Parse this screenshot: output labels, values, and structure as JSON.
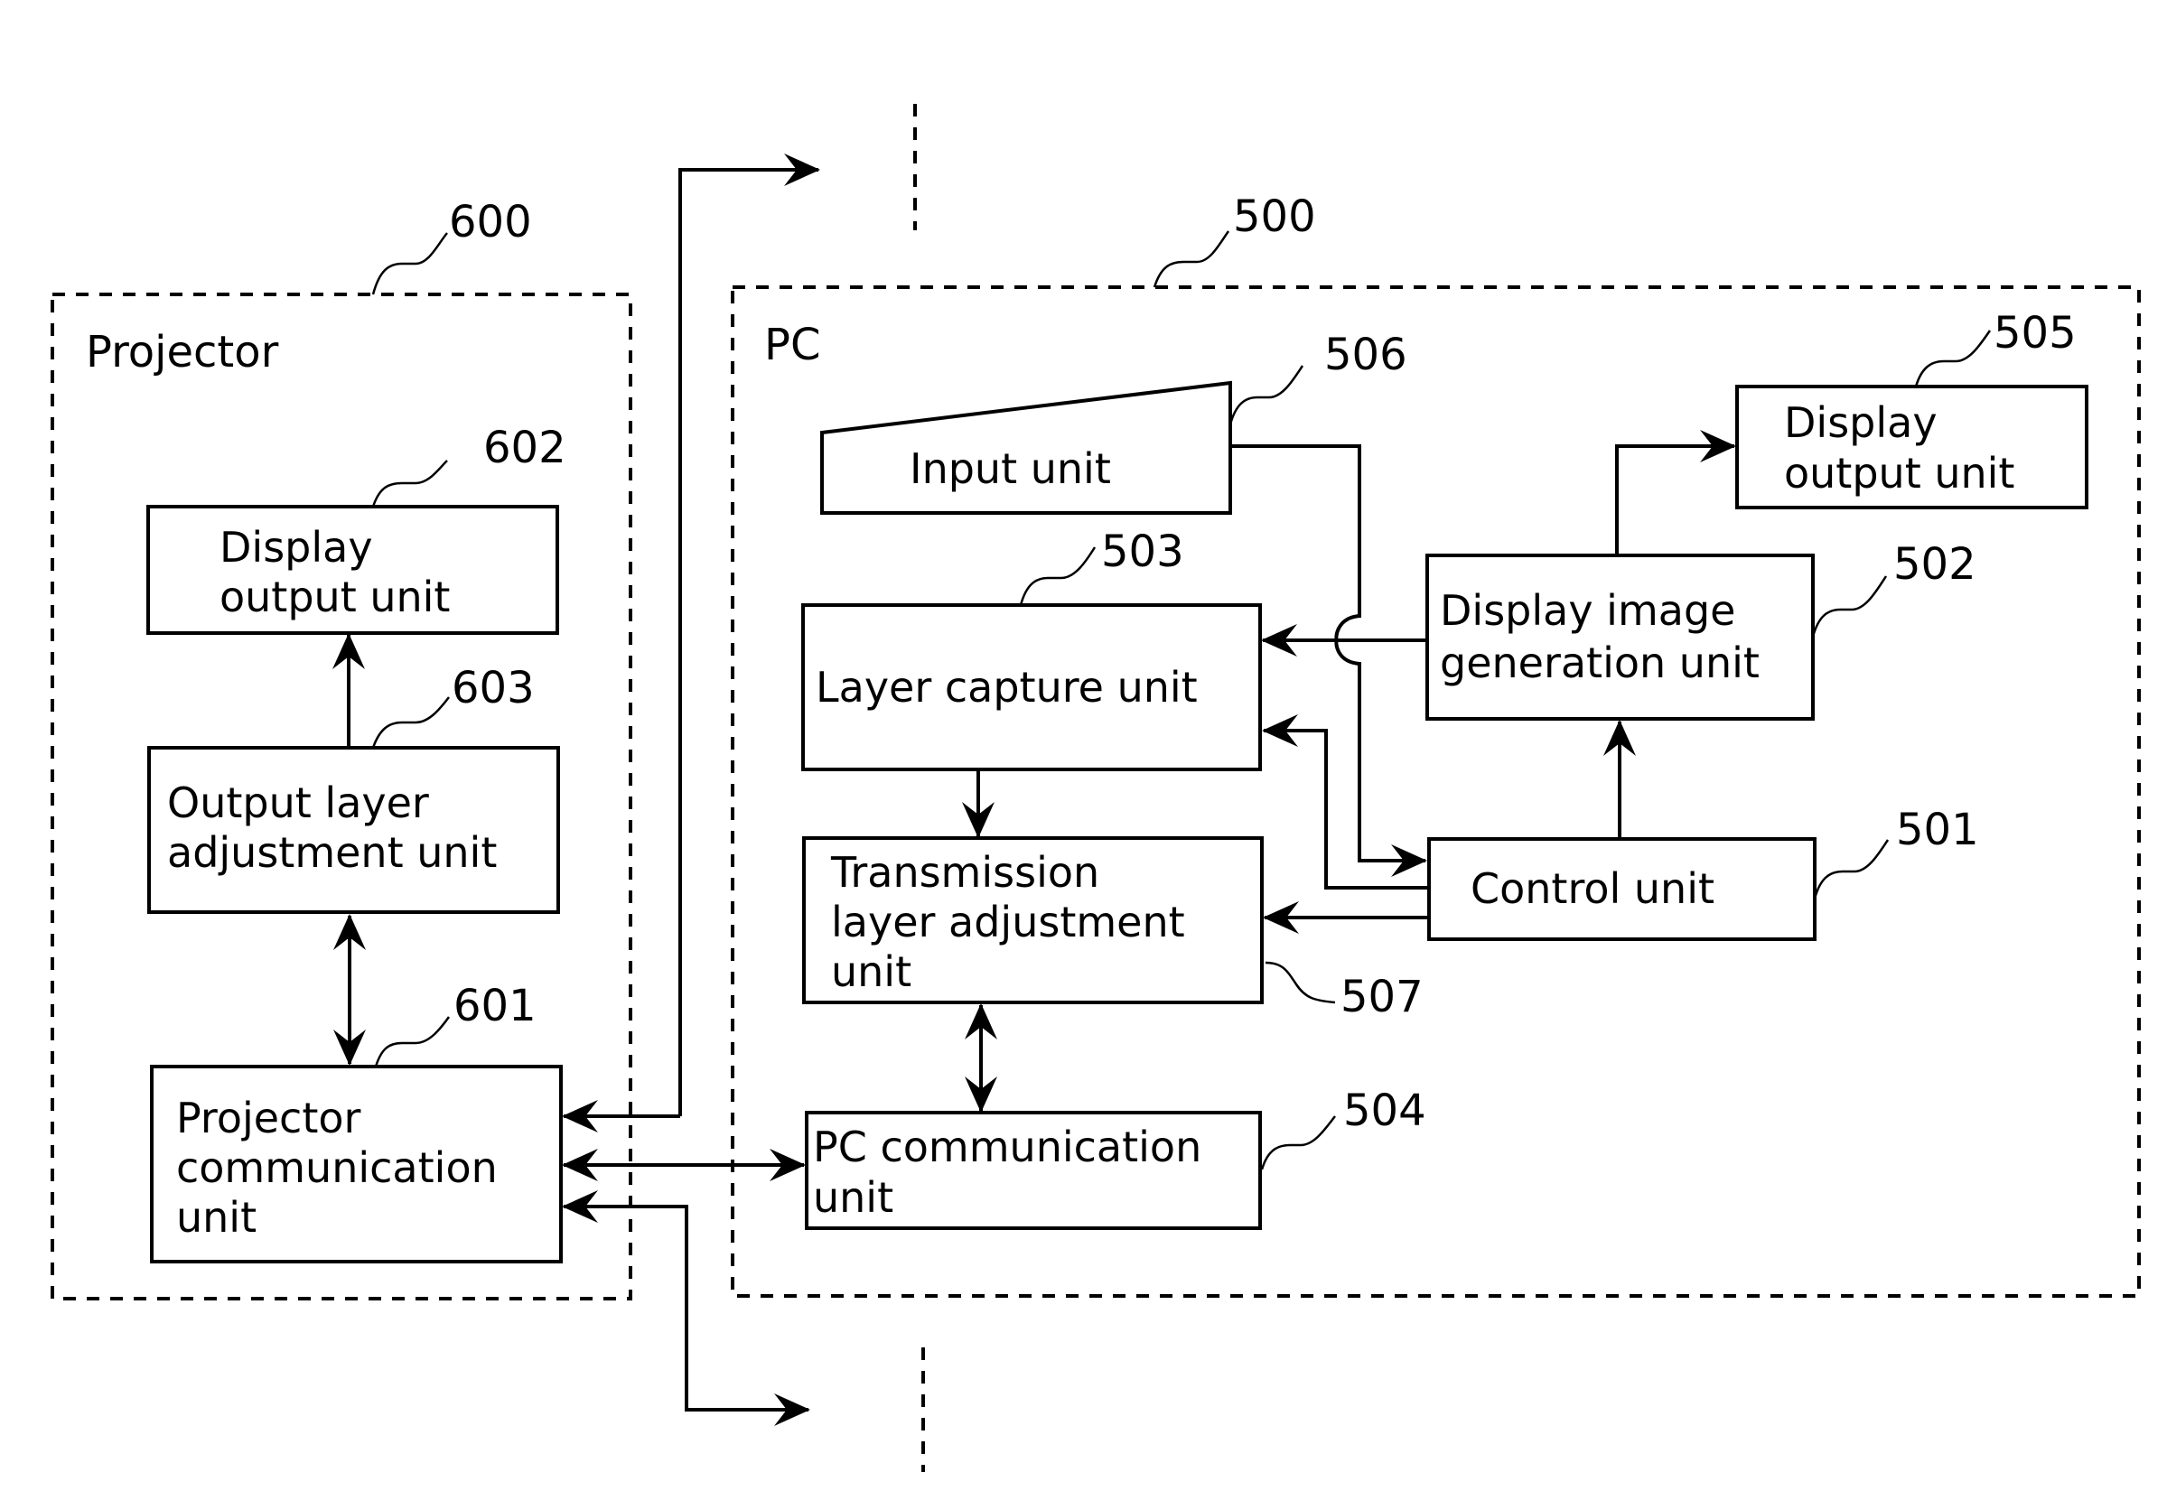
{
  "diagram": {
    "groups": {
      "projector": {
        "label": "Projector",
        "ref": "600"
      },
      "pc": {
        "label": "PC",
        "ref": "500"
      }
    },
    "blocks": {
      "proj_display_output": {
        "ref": "602",
        "lines": [
          "Display",
          "output unit"
        ]
      },
      "output_layer_adjustment": {
        "ref": "603",
        "lines": [
          "Output layer",
          "adjustment unit"
        ]
      },
      "projector_communication": {
        "ref": "601",
        "lines": [
          "Projector",
          "communication",
          "unit"
        ]
      },
      "input_unit": {
        "ref": "506",
        "lines": [
          "Input unit"
        ]
      },
      "pc_display_output": {
        "ref": "505",
        "lines": [
          "Display",
          "output unit"
        ]
      },
      "layer_capture": {
        "ref": "503",
        "lines": [
          "Layer capture unit"
        ]
      },
      "display_image_generation": {
        "ref": "502",
        "lines": [
          "Display image",
          "generation unit"
        ]
      },
      "transmission_layer_adjustment": {
        "ref": "507",
        "lines": [
          "Transmission",
          "layer adjustment",
          "unit"
        ]
      },
      "control_unit": {
        "ref": "501",
        "lines": [
          "Control unit"
        ]
      },
      "pc_communication": {
        "ref": "504",
        "lines": [
          "PC communication",
          "unit"
        ]
      }
    },
    "connections": [
      {
        "from": "output_layer_adjustment",
        "to": "proj_display_output",
        "type": "one-way"
      },
      {
        "from": "output_layer_adjustment",
        "to": "projector_communication",
        "type": "two-way"
      },
      {
        "from": "projector_communication",
        "to": "pc_communication",
        "type": "two-way"
      },
      {
        "from": "external_top",
        "to": "projector_communication",
        "type": "one-way-in/out"
      },
      {
        "from": "external_bottom",
        "to": "projector_communication",
        "type": "one-way-in/out"
      },
      {
        "from": "input_unit",
        "to": "control_unit",
        "type": "one-way"
      },
      {
        "from": "display_image_generation",
        "to": "layer_capture",
        "type": "one-way"
      },
      {
        "from": "display_image_generation",
        "to": "pc_display_output",
        "type": "one-way"
      },
      {
        "from": "control_unit",
        "to": "display_image_generation",
        "type": "one-way"
      },
      {
        "from": "control_unit",
        "to": "layer_capture",
        "type": "one-way"
      },
      {
        "from": "control_unit",
        "to": "transmission_layer_adjustment",
        "type": "one-way"
      },
      {
        "from": "layer_capture",
        "to": "transmission_layer_adjustment",
        "type": "one-way"
      },
      {
        "from": "transmission_layer_adjustment",
        "to": "pc_communication",
        "type": "two-way"
      }
    ]
  }
}
